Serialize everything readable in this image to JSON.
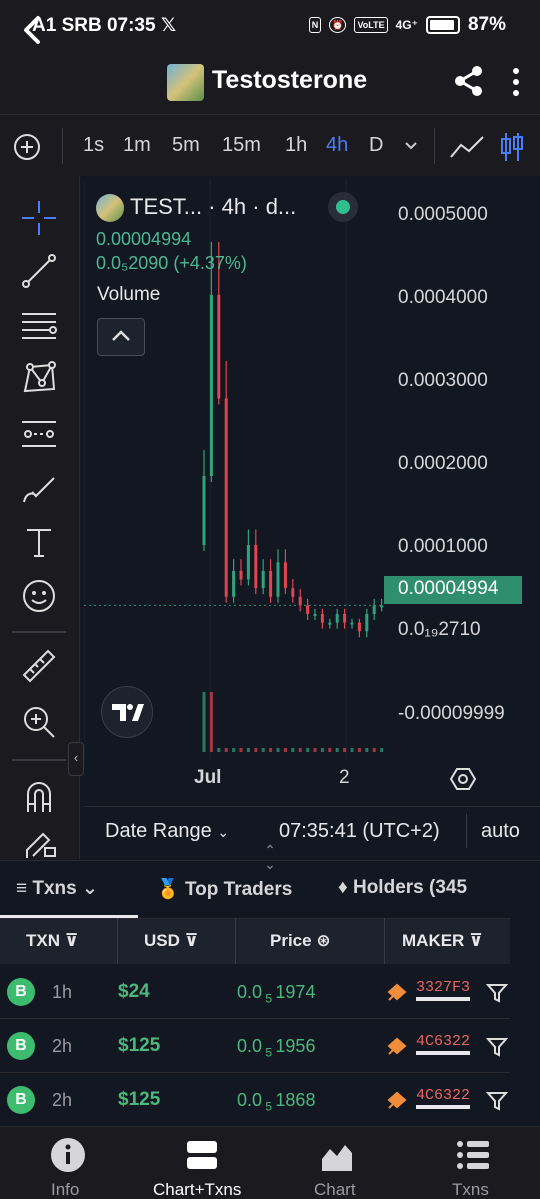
{
  "status_bar": {
    "left_text": "A1 SRB 07:35",
    "x_icon": "𝕏",
    "volte_label": "VoLTE",
    "signal_label": "4G⁺",
    "battery": "87%"
  },
  "header": {
    "title": "Testosterone",
    "back_icon": "back-arrow-icon",
    "share_icon": "share-icon",
    "more_icon": "more-vertical-icon"
  },
  "intervals": {
    "add_icon": "plus-circle-icon",
    "items": [
      "1s",
      "1m",
      "5m",
      "15m",
      "1h",
      "4h",
      "D"
    ],
    "active": "4h",
    "dropdown_icon": "chevron-down-icon",
    "chart_type_icons": [
      "line-chart-icon",
      "candles-icon"
    ]
  },
  "chart": {
    "legend_title": "TEST... · 4h · d...",
    "legend_price": "0.00004994",
    "legend_change": "0.0₅2090 (+4.37%)",
    "volume_label": "Volume",
    "y_labels": [
      "0.0005000",
      "0.0004000",
      "0.0003000",
      "0.0002000",
      "0.0001000",
      "0.0₁₉2710",
      "-0.00009999"
    ],
    "current_price_tag": "0.00004994",
    "x_labels": [
      "Jul",
      "2"
    ],
    "date_range": "Date Range",
    "clock": "07:35:41 (UTC+2)",
    "auto": "auto",
    "colors": {
      "up": "#2fa37a",
      "down": "#e0464f",
      "price_line": "#2e8e6e"
    }
  },
  "chart_data": {
    "type": "line",
    "title": "",
    "y_labels_shown": [
      "0.0005000",
      "0.0004000",
      "0.0003000",
      "0.0002000",
      "0.0001000",
      "0.0₁₉2710",
      "-0.00009999"
    ],
    "ylim": [
      -0.00012,
      0.00052
    ],
    "x_labels": [
      "Jul",
      "2"
    ],
    "series": [
      {
        "values": [
          0.0002,
          0.00041,
          0.00029,
          6e-05,
          9e-05,
          8e-05,
          0.00012,
          7e-05,
          9e-05,
          6e-05,
          0.0001,
          7e-05,
          6e-05,
          5e-05,
          4e-05,
          4e-05,
          3e-05,
          3e-05,
          4e-05,
          3e-05,
          3e-05,
          2e-05,
          4e-05,
          5e-05,
          5e-05
        ]
      }
    ],
    "current_price": 4.994e-05,
    "grid": true
  },
  "tabs": {
    "txns": "Txns",
    "top_traders": "Top Traders",
    "holders": "Holders (345"
  },
  "table": {
    "headers": {
      "txn": "TXN",
      "usd": "USD",
      "price": "Price",
      "maker": "MAKER"
    },
    "rows": [
      {
        "type": "B",
        "age": "1h",
        "usd": "$24",
        "price_prefix": "0.0",
        "price_sub": "5",
        "price_rest": "1974",
        "maker": "3327F3"
      },
      {
        "type": "B",
        "age": "2h",
        "usd": "$125",
        "price_prefix": "0.0",
        "price_sub": "5",
        "price_rest": "1956",
        "maker": "4C6322"
      },
      {
        "type": "B",
        "age": "2h",
        "usd": "$125",
        "price_prefix": "0.0",
        "price_sub": "5",
        "price_rest": "1868",
        "maker": "4C6322"
      }
    ]
  },
  "bottom_nav": {
    "items": [
      {
        "label": "Info",
        "icon": "info-icon"
      },
      {
        "label": "Chart+Txns",
        "icon": "chart-txns-icon"
      },
      {
        "label": "Chart",
        "icon": "area-chart-icon"
      },
      {
        "label": "Txns",
        "icon": "list-icon"
      }
    ],
    "active": "Chart+Txns"
  }
}
